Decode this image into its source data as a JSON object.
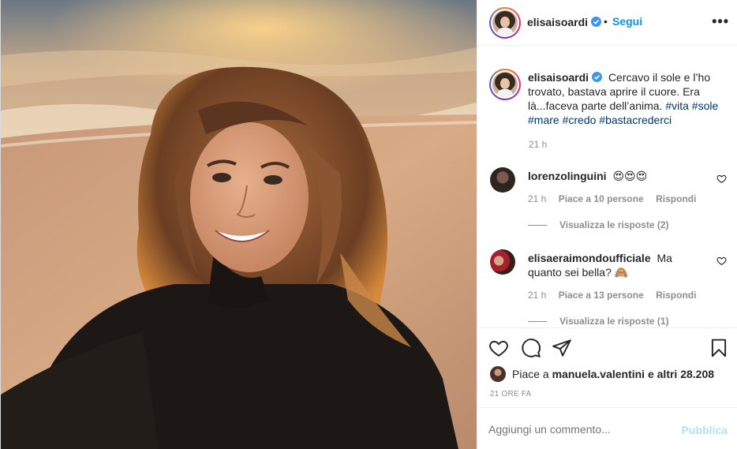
{
  "post": {
    "username": "elisaisoardi",
    "verified": true,
    "follow_separator": "•",
    "follow_label": "Segui",
    "more_label": "•••"
  },
  "caption": {
    "username": "elisaisoardi",
    "text": "Cercavo il sole e l’ho trovato, bastava aprire il cuore. Era là...faceva parte dell’anima.",
    "hashtags": [
      "#vita",
      "#sole",
      "#mare",
      "#credo",
      "#bastacrederci"
    ],
    "time": "21 h"
  },
  "comments": [
    {
      "username": "lorenzolinguini",
      "text": "😍😍😍",
      "time": "21 h",
      "likes": "Piace a 10 persone",
      "reply_label": "Rispondi",
      "view_replies": "Visualizza le risposte (2)"
    },
    {
      "username": "elisaeraimondoufficiale",
      "text": "Ma quanto sei bella? 🙈",
      "time": "21 h",
      "likes": "Piace a 13 persone",
      "reply_label": "Rispondi",
      "view_replies": "Visualizza le risposte (1)"
    }
  ],
  "likes_summary": {
    "prefix": "Piace a",
    "user": "manuela.valentini",
    "suffix": "e altri 28.208"
  },
  "date_label": "21 ORE FA",
  "comment_box": {
    "placeholder": "Aggiungi un commento...",
    "publish_label": "Pubblica"
  },
  "icons": {
    "like": "heart-icon",
    "comment": "comment-icon",
    "share": "send-icon",
    "save": "bookmark-icon",
    "verified": "verified-badge-icon",
    "more": "more-options-icon"
  },
  "colors": {
    "link_blue": "#0095f6",
    "publish_disabled": "#b2dffc",
    "muted_text": "#8e8e8e",
    "hashtag": "#00376b",
    "verified": "#3897f0"
  }
}
